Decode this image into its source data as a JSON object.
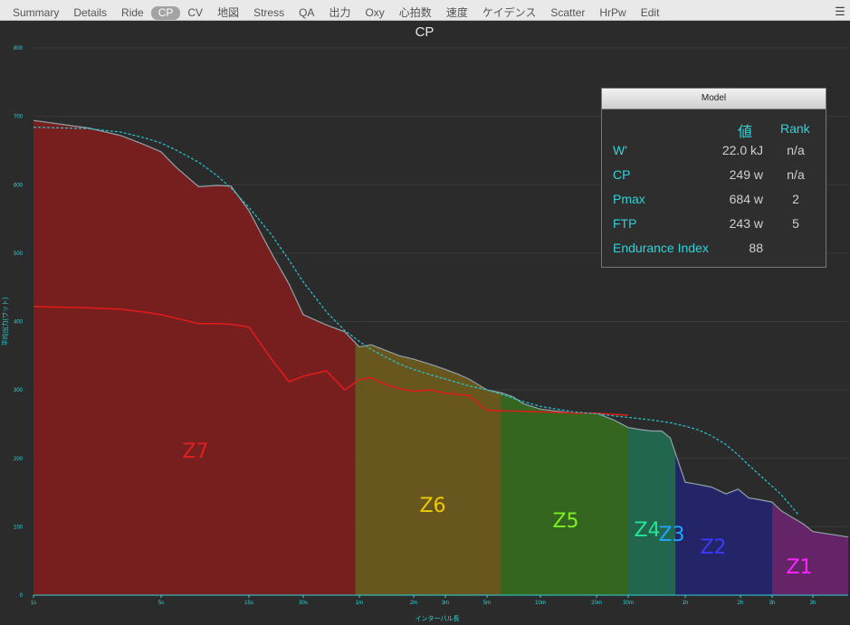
{
  "tabs": [
    {
      "label": "Summary"
    },
    {
      "label": "Details"
    },
    {
      "label": "Ride"
    },
    {
      "label": "CP",
      "active": true
    },
    {
      "label": "CV"
    },
    {
      "label": "地図"
    },
    {
      "label": "Stress"
    },
    {
      "label": "QA"
    },
    {
      "label": "出力"
    },
    {
      "label": "Oxy"
    },
    {
      "label": "心拍数"
    },
    {
      "label": "速度"
    },
    {
      "label": "ケイデンス"
    },
    {
      "label": "Scatter"
    },
    {
      "label": "HrPw"
    },
    {
      "label": "Edit"
    }
  ],
  "menu_icon": "hamburger-menu-icon",
  "colors": {
    "background": "#2b2b2b",
    "accent": "#2fd3d9",
    "ride_curve": "#e21b1b",
    "model_curve": "#27c5d0"
  },
  "chart_data": {
    "type": "area",
    "title": "CP",
    "xlabel": "インターバル長",
    "ylabel": "平均出力(ワット)",
    "x_scale": "log",
    "xlim_seconds": [
      1,
      10800
    ],
    "ylim": [
      0,
      800
    ],
    "yticks": [
      0,
      100,
      200,
      300,
      400,
      500,
      600,
      700,
      800
    ],
    "xticks": [
      {
        "label": "1s",
        "sec": 1
      },
      {
        "label": "5s",
        "sec": 5
      },
      {
        "label": "15s",
        "sec": 15
      },
      {
        "label": "30s",
        "sec": 30
      },
      {
        "label": "1m",
        "sec": 60
      },
      {
        "label": "2m",
        "sec": 120
      },
      {
        "label": "3m",
        "sec": 180
      },
      {
        "label": "5m",
        "sec": 300
      },
      {
        "label": "10m",
        "sec": 600
      },
      {
        "label": "20m",
        "sec": 1200
      },
      {
        "label": "30m",
        "sec": 1800
      },
      {
        "label": "1h",
        "sec": 3600
      },
      {
        "label": "2h",
        "sec": 7200
      },
      {
        "label": "3h",
        "sec": 10800
      },
      {
        "label": "3h",
        "sec": 18000
      }
    ],
    "grid": true,
    "series": [
      {
        "name": "best",
        "x": [
          1,
          2,
          3,
          4,
          5,
          6,
          8,
          10,
          12,
          15,
          20,
          25,
          30,
          40,
          50,
          60,
          70,
          80,
          100,
          120,
          150,
          180,
          210,
          240,
          300,
          360,
          420,
          480,
          600,
          900,
          1200,
          1500,
          1800,
          2100,
          2400,
          2700,
          3000,
          3600,
          4000,
          5000,
          6000,
          7000,
          8000,
          9000,
          10800,
          12000,
          14000,
          16000,
          18000,
          20000
        ],
        "y": [
          694,
          683,
          672,
          659,
          648,
          626,
          597,
          599,
          598,
          562,
          500,
          455,
          410,
          395,
          385,
          363,
          366,
          360,
          350,
          345,
          337,
          330,
          323,
          316,
          300,
          296,
          290,
          280,
          272,
          266,
          266,
          256,
          245,
          242,
          240,
          240,
          230,
          165,
          163,
          158,
          148,
          155,
          142,
          140,
          136,
          124,
          113,
          104,
          93,
          85
        ]
      },
      {
        "name": "ride",
        "x": [
          1,
          2,
          3,
          4,
          5,
          6,
          8,
          10,
          12,
          15,
          20,
          25,
          30,
          40,
          50,
          60,
          70,
          80,
          100,
          120,
          150,
          180,
          240,
          300,
          600,
          900,
          1200,
          1800
        ],
        "y": [
          422,
          420,
          418,
          414,
          410,
          405,
          397,
          397,
          396,
          392,
          345,
          312,
          320,
          328,
          300,
          315,
          318,
          310,
          302,
          298,
          300,
          295,
          292,
          270,
          268,
          266,
          266,
          263
        ]
      },
      {
        "name": "model",
        "x": [
          1,
          2,
          3,
          4,
          5,
          6,
          8,
          10,
          12,
          15,
          20,
          25,
          30,
          40,
          50,
          60,
          70,
          80,
          100,
          120,
          150,
          180,
          240,
          300,
          360,
          420,
          480,
          600,
          900,
          1200,
          1500,
          1800,
          2400,
          3000,
          3600,
          4200,
          5000,
          6000,
          7000,
          8000,
          10000,
          12000,
          15000
        ],
        "y": [
          684,
          682,
          677,
          669,
          661,
          651,
          633,
          614,
          595,
          567,
          527,
          490,
          458,
          414,
          387,
          371,
          359,
          351,
          338,
          330,
          322,
          316,
          306,
          300,
          294,
          288,
          283,
          276,
          268,
          265,
          262,
          260,
          256,
          252,
          247,
          242,
          233,
          220,
          205,
          190,
          167,
          148,
          118
        ]
      }
    ],
    "zones": [
      {
        "label": "Z7",
        "x_start": 1,
        "x_end": 57,
        "color": "#7e1e1e",
        "label_color": "#e02020"
      },
      {
        "label": "Z6",
        "x_start": 57,
        "x_end": 360,
        "color": "#6e5a1e",
        "label_color": "#f0c800"
      },
      {
        "label": "Z5",
        "x_start": 360,
        "x_end": 1800,
        "color": "#356b1e",
        "label_color": "#7cf022"
      },
      {
        "label": "Z4",
        "x_start": 1800,
        "x_end": 3200,
        "color": "#226b50",
        "label_color": "#21e898"
      },
      {
        "label": "Z3",
        "x_start": 3200,
        "x_end": 3200,
        "color": "#226b50",
        "label_color": "#20a6ff"
      },
      {
        "label": "Z2",
        "x_start": 3200,
        "x_end": 10800,
        "color": "#24246e",
        "label_color": "#3a3aff"
      },
      {
        "label": "Z1",
        "x_start": 10800,
        "x_end": 20000,
        "color": "#6a236e",
        "label_color": "#ff25ff"
      }
    ]
  },
  "legend": {
    "title": "Model",
    "col_value": "値",
    "col_rank": "Rank",
    "rows": [
      {
        "name": "W'",
        "value": "22.0 kJ",
        "rank": "n/a"
      },
      {
        "name": "CP",
        "value": "249 w",
        "rank": "n/a"
      },
      {
        "name": "Pmax",
        "value": "684 w",
        "rank": "2"
      },
      {
        "name": "FTP",
        "value": "243 w",
        "rank": "5"
      },
      {
        "name": "Endurance Index",
        "value": "88",
        "rank": ""
      }
    ]
  }
}
